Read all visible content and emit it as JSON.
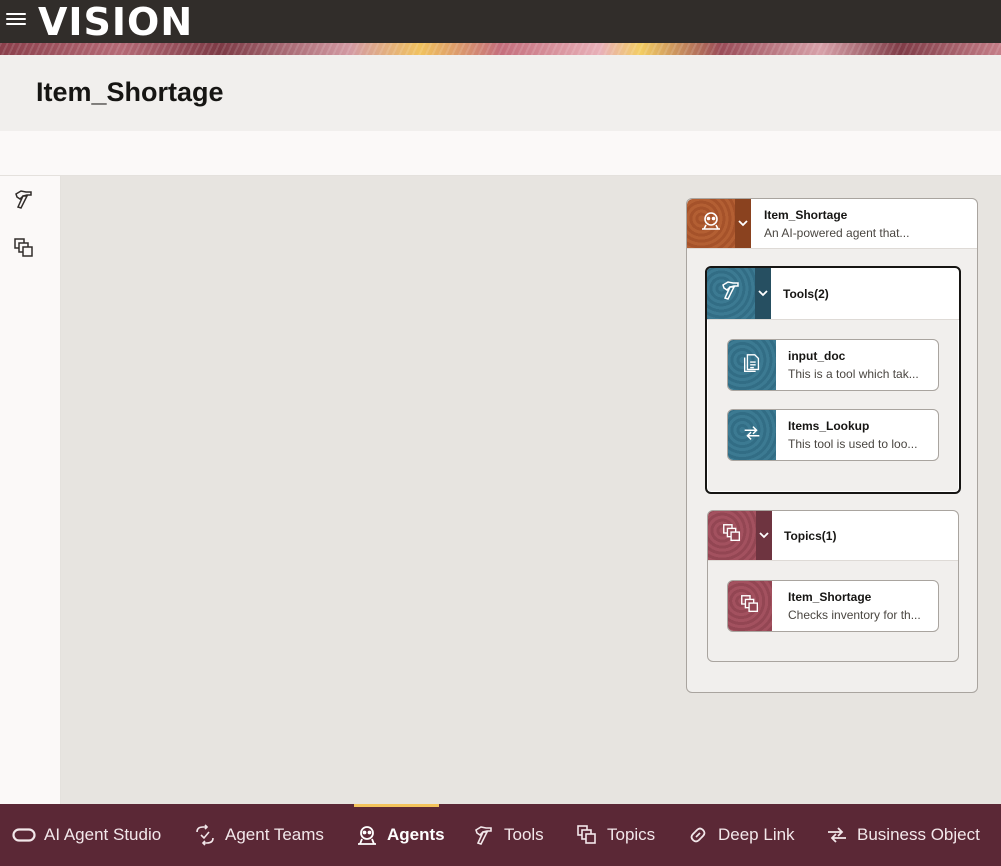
{
  "header": {
    "brand": "VISION"
  },
  "page": {
    "title": "Item_Shortage"
  },
  "agent": {
    "name": "Item_Shortage",
    "description": "An AI-powered agent that..."
  },
  "tools_group": {
    "title": "Tools(2)",
    "items": [
      {
        "name": "input_doc",
        "description": "This is a tool which tak..."
      },
      {
        "name": "Items_Lookup",
        "description": "This tool is used to loo..."
      }
    ]
  },
  "topics_group": {
    "title": "Topics(1)",
    "items": [
      {
        "name": "Item_Shortage",
        "description": "Checks inventory for th..."
      }
    ]
  },
  "bottom_nav": {
    "items": [
      {
        "label": "AI Agent Studio",
        "icon": "oracle-logo-icon"
      },
      {
        "label": "Agent Teams",
        "icon": "agent-teams-icon"
      },
      {
        "label": "Agents",
        "icon": "agent-icon",
        "active": true
      },
      {
        "label": "Tools",
        "icon": "hammer-icon"
      },
      {
        "label": "Topics",
        "icon": "topics-icon"
      },
      {
        "label": "Deep Link",
        "icon": "link-icon"
      },
      {
        "label": "Business Object",
        "icon": "business-object-icon"
      }
    ]
  },
  "colors": {
    "topbar": "#312d2a",
    "bottom_nav": "#5b2836",
    "active_indicator": "#f3c35b",
    "agent_tile": "#a5522a",
    "tools_tile": "#326d85",
    "topics_tile": "#934653"
  }
}
